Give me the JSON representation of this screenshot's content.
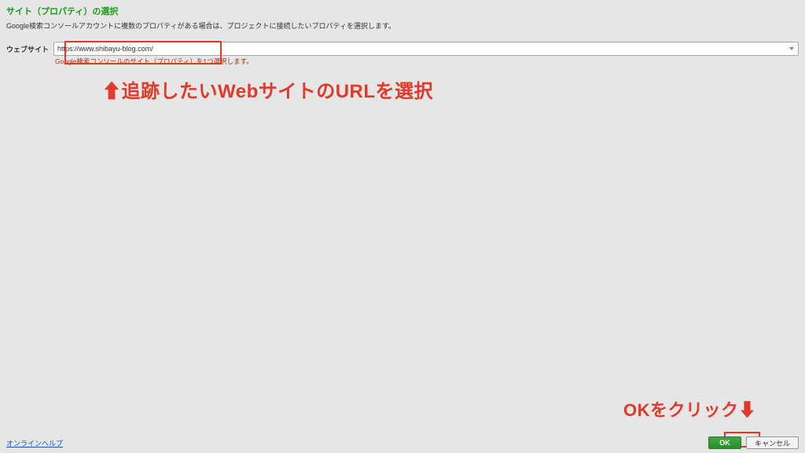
{
  "colors": {
    "title_green": "#1a9e1a",
    "annotation_red": "#e23a2a",
    "ok_button_green": "#3fa83f",
    "link_blue": "#1155cc"
  },
  "header": {
    "title": "サイト（プロパティ）の選択",
    "subtitle": "Google検索コンソールアカウントに複数のプロパティがある場合は、プロジェクトに接続したいプロパティを選択します。"
  },
  "field": {
    "label": "ウェブサイト",
    "dropdown_value": "https://www.shibayu-blog.com/",
    "helper_text": "Google検索コンソールのサイト（プロパティ）を1つ選択します。"
  },
  "annotations": {
    "top": "⬆追跡したいWebサイトのURLを選択",
    "bottom": "OKをクリック⬇"
  },
  "footer": {
    "help_link": "オンラインヘルプ",
    "ok_button": "OK",
    "cancel_button": "キャンセル"
  }
}
